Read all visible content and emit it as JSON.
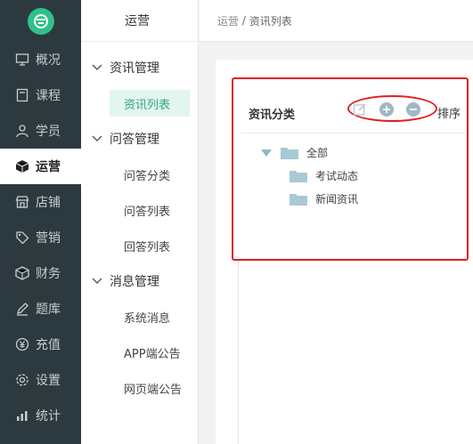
{
  "rail": {
    "items": [
      {
        "label": "概况",
        "icon": "monitor-icon"
      },
      {
        "label": "课程",
        "icon": "book-icon"
      },
      {
        "label": "学员",
        "icon": "user-icon"
      },
      {
        "label": "运营",
        "icon": "cube-icon",
        "active": true
      },
      {
        "label": "店铺",
        "icon": "store-icon"
      },
      {
        "label": "营销",
        "icon": "tag-icon"
      },
      {
        "label": "财务",
        "icon": "wallet-icon"
      },
      {
        "label": "题库",
        "icon": "pen-icon"
      },
      {
        "label": "充值",
        "icon": "yen-icon"
      },
      {
        "label": "设置",
        "icon": "gear-icon"
      },
      {
        "label": "统计",
        "icon": "bar-chart-icon"
      }
    ]
  },
  "submenu": {
    "title": "运营",
    "groups": [
      {
        "label": "资讯管理",
        "items": [
          {
            "label": "资讯列表",
            "active": true
          }
        ]
      },
      {
        "label": "问答管理",
        "items": [
          {
            "label": "问答分类"
          },
          {
            "label": "问答列表"
          },
          {
            "label": "回答列表"
          }
        ]
      },
      {
        "label": "消息管理",
        "items": [
          {
            "label": "系统消息"
          },
          {
            "label": "APP端公告"
          },
          {
            "label": "网页端公告"
          }
        ]
      }
    ]
  },
  "breadcrumb": {
    "root": "运营",
    "separator": " / ",
    "current": "资讯列表"
  },
  "category_panel": {
    "title": "资讯分类",
    "sort_label": "排序",
    "tools": [
      "edit-icon",
      "add-circle-icon",
      "remove-circle-icon"
    ],
    "tree": {
      "root": "全部",
      "children": [
        "考试动态",
        "新闻资讯"
      ]
    }
  },
  "colors": {
    "rail_bg": "#2c3a3f",
    "accent": "#2ea87e",
    "highlight": "#e02020",
    "folder": "#a9c9d6"
  }
}
